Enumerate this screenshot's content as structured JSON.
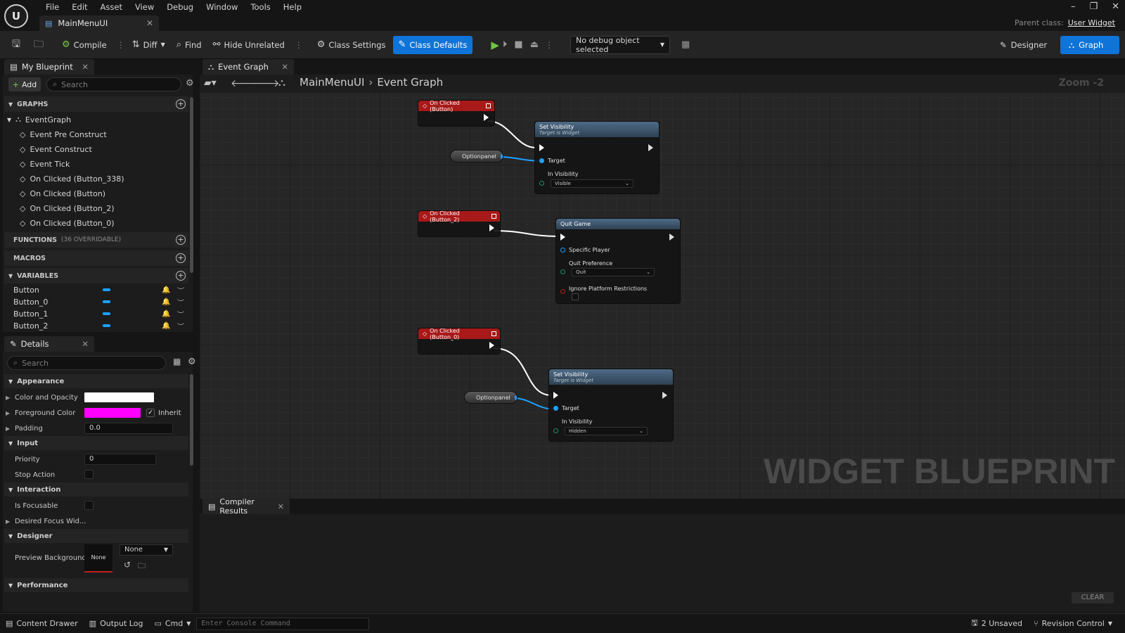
{
  "app": {
    "logo_text": "U",
    "menu": [
      "File",
      "Edit",
      "Asset",
      "View",
      "Debug",
      "Window",
      "Tools",
      "Help"
    ],
    "document_tab": "MainMenuUI",
    "parent_class_label": "Parent class:",
    "parent_class_value": "User Widget"
  },
  "toolbar": {
    "compile": "Compile",
    "diff": "Diff",
    "find": "Find",
    "hide_unrelated": "Hide Unrelated",
    "class_settings": "Class Settings",
    "class_defaults": "Class Defaults",
    "debug_object": "No debug object selected",
    "designer": "Designer",
    "graph": "Graph"
  },
  "my_blueprint": {
    "tab": "My Blueprint",
    "add": "Add",
    "search_placeholder": "Search",
    "graphs_header": "GRAPHS",
    "event_graph": "EventGraph",
    "events": [
      "Event Pre Construct",
      "Event Construct",
      "Event Tick",
      "On Clicked (Button_338)",
      "On Clicked (Button)",
      "On Clicked (Button_2)",
      "On Clicked (Button_0)"
    ],
    "functions_header": "FUNCTIONS",
    "functions_sub": "(36 OVERRIDABLE)",
    "macros_header": "MACROS",
    "variables_header": "VARIABLES",
    "variables": [
      "Button",
      "Button_0",
      "Button_1",
      "Button_2"
    ]
  },
  "details": {
    "tab": "Details",
    "search_placeholder": "Search",
    "appearance": "Appearance",
    "color_and_opacity": "Color and Opacity",
    "foreground_color": "Foreground Color",
    "inherit": "Inherit",
    "padding": "Padding",
    "padding_value": "0.0",
    "input": "Input",
    "priority": "Priority",
    "priority_value": "0",
    "stop_action": "Stop Action",
    "interaction": "Interaction",
    "is_focusable": "Is Focusable",
    "desired_focus": "Desired Focus Wid...",
    "designer": "Designer",
    "preview_background": "Preview Background",
    "preview_swatch": "None",
    "preview_select": "None",
    "performance": "Performance",
    "colors": {
      "color_and_opacity": "#ffffff",
      "foreground": "#ff00ff"
    }
  },
  "graph": {
    "tab": "Event Graph",
    "breadcrumb_root": "MainMenuUI",
    "breadcrumb_leaf": "Event Graph",
    "zoom": "Zoom -2",
    "watermark": "WIDGET BLUEPRINT",
    "nodes": {
      "ev1": "On Clicked (Button)",
      "ev2": "On Clicked (Button_2)",
      "ev3": "On Clicked (Button_0)",
      "setvis_title": "Set Visibility",
      "target_sub": "Target is Widget",
      "target": "Target",
      "in_visibility": "In Visibility",
      "visible": "Visible",
      "hidden": "Hidden",
      "optionpanel": "Optionpanel",
      "quit_title": "Quit Game",
      "specific_player": "Specific Player",
      "quit_preference": "Quit Preference",
      "quit": "Quit",
      "ignore_platform": "Ignore Platform Restrictions"
    }
  },
  "compiler": {
    "tab": "Compiler Results",
    "clear": "CLEAR"
  },
  "status": {
    "content_drawer": "Content Drawer",
    "output_log": "Output Log",
    "cmd": "Cmd",
    "console_placeholder": "Enter Console Command",
    "unsaved": "2 Unsaved",
    "revision": "Revision Control"
  }
}
